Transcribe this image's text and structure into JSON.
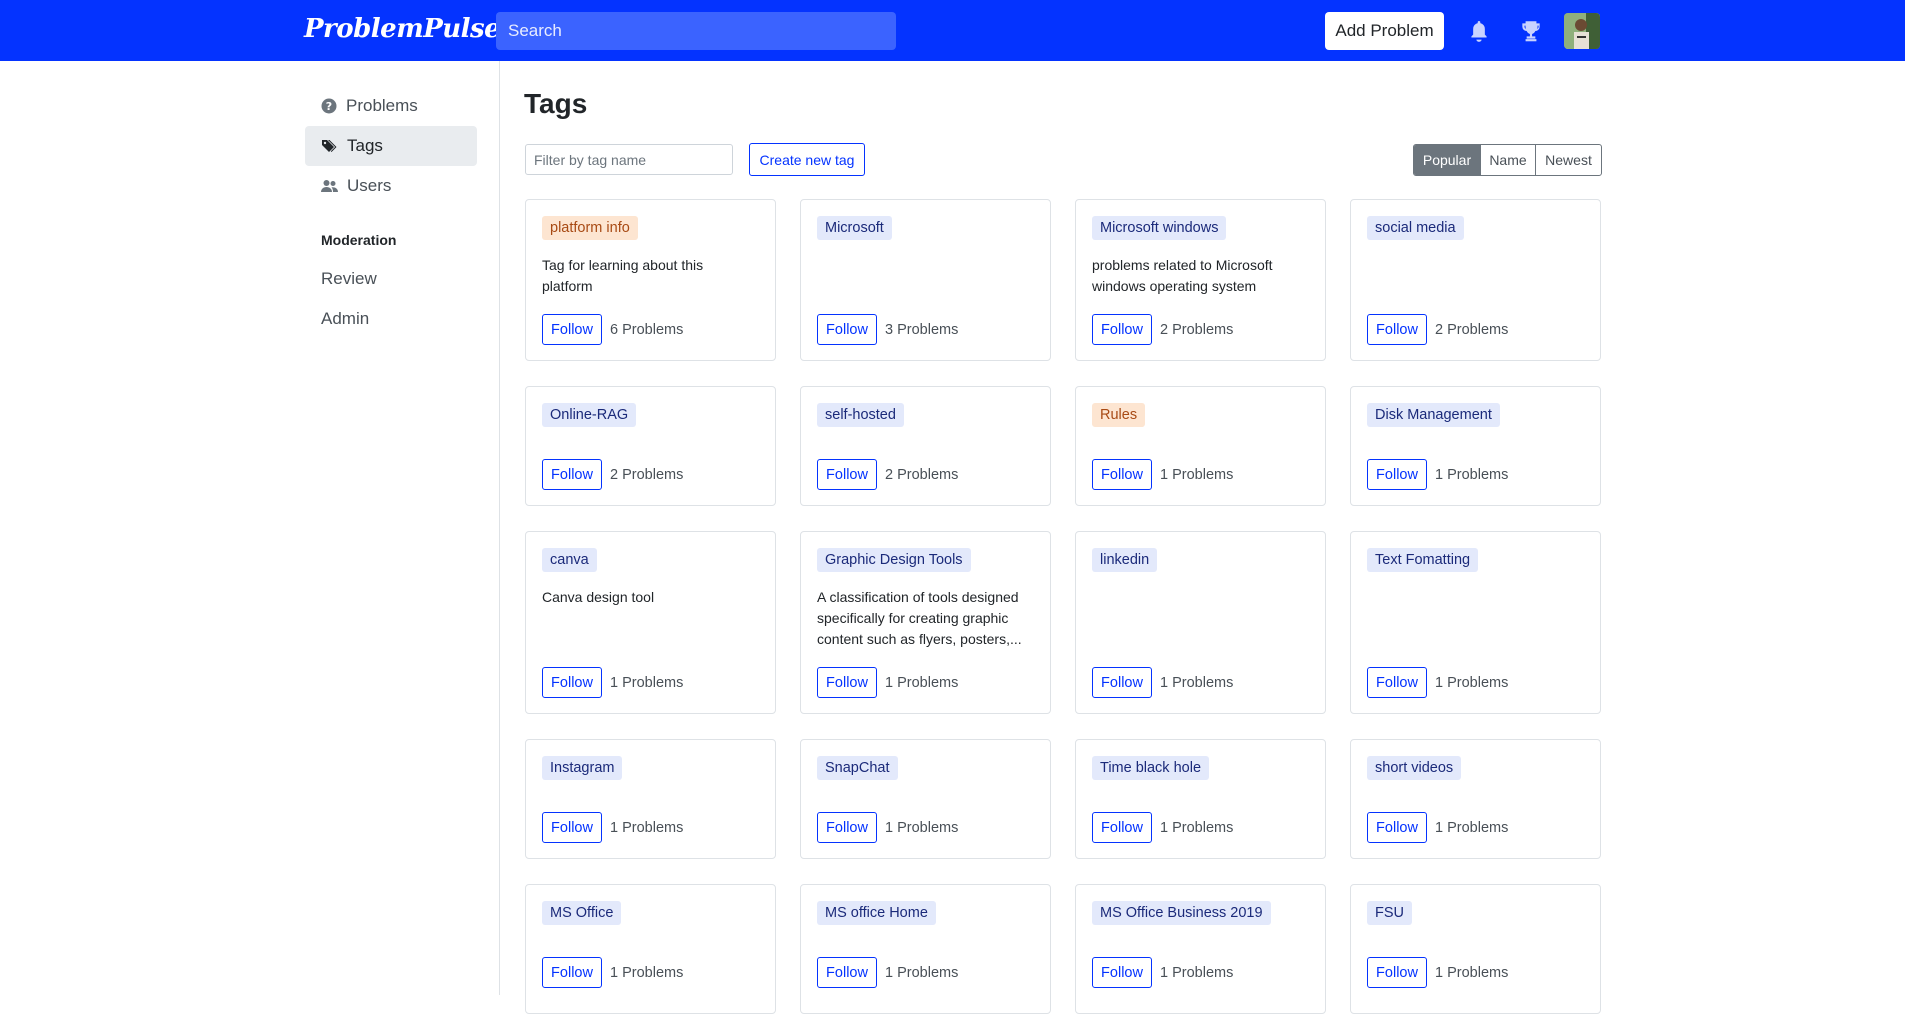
{
  "header": {
    "logo": "ProblemPulse",
    "search_placeholder": "Search",
    "add_problem_label": "Add Problem",
    "icons": [
      "bell-icon",
      "trophy-icon"
    ],
    "brand_color": "#0433ff"
  },
  "sidebar": {
    "items": [
      {
        "label": "Problems",
        "icon": "question-circle-icon"
      },
      {
        "label": "Tags",
        "icon": "tags-icon"
      },
      {
        "label": "Users",
        "icon": "people-icon"
      }
    ],
    "moderation_heading": "Moderation",
    "moderation_links": [
      "Review",
      "Admin"
    ]
  },
  "main": {
    "title": "Tags",
    "filter_placeholder": "Filter by tag name",
    "create_label": "Create new tag",
    "sort_options": [
      "Popular",
      "Name",
      "Newest"
    ],
    "sort_selected": "Popular",
    "follow_label": "Follow",
    "cards": [
      {
        "tag": "platform info",
        "style": "orange",
        "desc": [
          "Tag for learning about this",
          "platform"
        ],
        "count": "6 Problems"
      },
      {
        "tag": "Microsoft",
        "style": "blue",
        "desc": [],
        "count": "3 Problems"
      },
      {
        "tag": "Microsoft windows",
        "style": "blue",
        "desc": [
          "problems related to Microsoft",
          "windows operating system"
        ],
        "count": "2 Problems"
      },
      {
        "tag": "social media",
        "style": "blue",
        "desc": [],
        "count": "2 Problems"
      },
      {
        "tag": "Online-RAG",
        "style": "blue",
        "desc": [],
        "count": "2 Problems"
      },
      {
        "tag": "self-hosted",
        "style": "blue",
        "desc": [],
        "count": "2 Problems"
      },
      {
        "tag": "Rules",
        "style": "orange",
        "desc": [],
        "count": "1 Problems"
      },
      {
        "tag": "Disk Management",
        "style": "blue",
        "desc": [],
        "count": "1 Problems"
      },
      {
        "tag": "canva",
        "style": "blue",
        "desc": [
          "Canva design tool"
        ],
        "count": "1 Problems"
      },
      {
        "tag": "Graphic Design Tools",
        "style": "blue",
        "desc": [
          "A classification of tools designed",
          "specifically for creating graphic",
          "content such as flyers, posters,..."
        ],
        "count": "1 Problems"
      },
      {
        "tag": "linkedin",
        "style": "blue",
        "desc": [],
        "count": "1 Problems"
      },
      {
        "tag": "Text Fomatting",
        "style": "blue",
        "desc": [],
        "count": "1 Problems"
      },
      {
        "tag": "Instagram",
        "style": "blue",
        "desc": [],
        "count": "1 Problems"
      },
      {
        "tag": "SnapChat",
        "style": "blue",
        "desc": [],
        "count": "1 Problems"
      },
      {
        "tag": "Time black hole",
        "style": "blue",
        "desc": [],
        "count": "1 Problems"
      },
      {
        "tag": "short videos",
        "style": "blue",
        "desc": [],
        "count": "1 Problems"
      },
      {
        "tag": "MS Office",
        "style": "blue",
        "desc": [],
        "count": "1 Problems"
      },
      {
        "tag": "MS office Home",
        "style": "blue",
        "desc": [],
        "count": "1 Problems"
      },
      {
        "tag": "MS Office Business 2019",
        "style": "blue",
        "desc": [],
        "count": "1 Problems"
      },
      {
        "tag": "FSU",
        "style": "blue",
        "desc": [],
        "count": "1 Problems"
      }
    ]
  }
}
